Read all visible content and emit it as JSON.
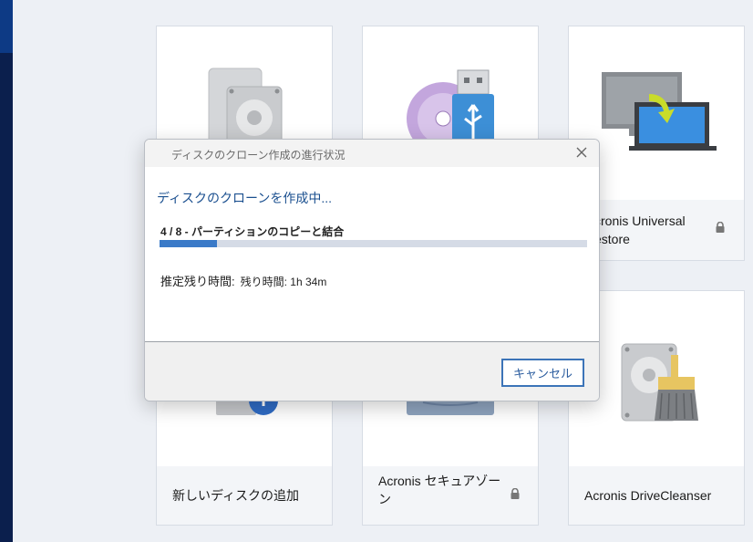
{
  "tiles": [
    {
      "label": "",
      "locked": false
    },
    {
      "label": "",
      "locked": false
    },
    {
      "label": "cronis Universal\nestore",
      "locked": true
    },
    {
      "label": "新しいディスクの追加",
      "locked": false
    },
    {
      "label": "Acronis セキュアゾー\nン",
      "locked": true
    },
    {
      "label": "Acronis DriveCleanser",
      "locked": false
    }
  ],
  "dialog": {
    "title": "ディスクのクローン作成の進行状況",
    "heading": "ディスクのクローンを作成中...",
    "step": "4 / 8 - パーティションのコピーと結合",
    "progress_fraction": 0.135,
    "remaining_label": "推定残り時間:",
    "remaining_value": "残り時間: 1h 34m",
    "cancel_label": "キャンセル"
  },
  "colors": {
    "accent": "#3a7ac8",
    "sidebar": "#0b1f4d",
    "heading": "#1a4f8f"
  },
  "icons": [
    "hdd-clone-icon",
    "media-usb-icon",
    "migrate-laptop-icon",
    "add-disk-icon",
    "secure-zone-icon",
    "drive-cleanser-icon",
    "lock-icon",
    "close-icon"
  ]
}
